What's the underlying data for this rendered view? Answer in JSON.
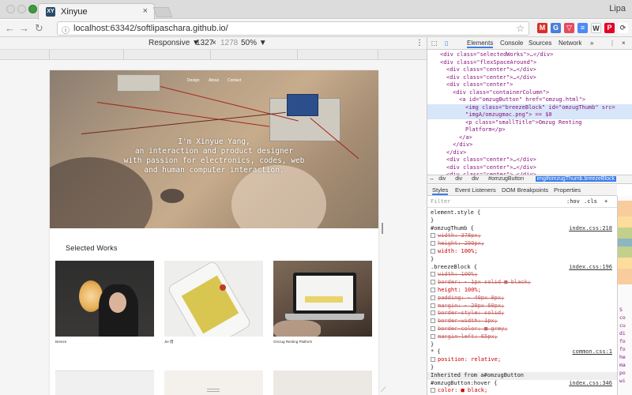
{
  "browser": {
    "tab_title": "Xinyue",
    "tab_favicon": "XY",
    "user_name": "Lipa",
    "url": "localhost:63342/softlipaschara.github.io/",
    "extension_icons": [
      "gmail-icon",
      "translate-icon",
      "pocket-icon",
      "docs-icon",
      "wikipedia-icon",
      "pinterest-icon",
      "sync-icon"
    ]
  },
  "device_toolbar": {
    "mode": "Responsive ▼",
    "width": "1327",
    "times": "×",
    "height": "1278",
    "zoom": "50% ▼"
  },
  "site": {
    "nav": [
      "Design",
      "About",
      "Contact"
    ],
    "hero_lines": [
      "I'm Xinyue Yang,",
      "an interaction and product designer",
      "with passion for electronics, codes, web",
      "and human computer interaction."
    ],
    "section_title": "Selected Works",
    "works": [
      {
        "caption": "Breeze",
        "thumb": "breeze-photo"
      },
      {
        "caption": "Jie 借",
        "thumb": "jie-phone-photo"
      },
      {
        "caption": "Omzug Renting Platform",
        "thumb": "omzug-laptop-photo"
      }
    ]
  },
  "devtools": {
    "tabs": [
      "Elements",
      "Console",
      "Sources",
      "Network",
      "»"
    ],
    "elements_lines": [
      {
        "indent": 2,
        "text": "<div class=\"selectedWorks\">…</div>"
      },
      {
        "indent": 2,
        "text": "<div class=\"flexSpaceAround\">"
      },
      {
        "indent": 3,
        "text": "<div class=\"center\">…</div>"
      },
      {
        "indent": 3,
        "text": "<div class=\"center\">…</div>"
      },
      {
        "indent": 3,
        "text": "<div class=\"center\">"
      },
      {
        "indent": 4,
        "text": "<div class=\"containerColumn\">"
      },
      {
        "indent": 5,
        "text": "<a id=\"omzugButton\" href=\"omzug.html\">"
      },
      {
        "indent": 6,
        "text": "<img class=\"breezeBlock\" id=\"omzugThumb\" src=",
        "selected": true
      },
      {
        "indent": 6,
        "text": "\"imgA/omzugmac.png\"> == $0",
        "selected": true
      },
      {
        "indent": 6,
        "text": "<p class=\"smallTitle\">Omzug Renting"
      },
      {
        "indent": 6,
        "text": "Platform</p>"
      },
      {
        "indent": 5,
        "text": "</a>"
      },
      {
        "indent": 4,
        "text": "</div>"
      },
      {
        "indent": 3,
        "text": "</div>"
      },
      {
        "indent": 3,
        "text": "<div class=\"center\">…</div>"
      },
      {
        "indent": 3,
        "text": "<div class=\"center\">…</div>"
      },
      {
        "indent": 3,
        "text": "<div class=\"center\">…</div>"
      }
    ],
    "breadcrumb": [
      "↔",
      "div",
      "div",
      "div",
      "#omzugButton",
      "img#omzugThumb.breezeBlock"
    ],
    "sub_tabs": [
      "Styles",
      "Event Listeners",
      "DOM Breakpoints",
      "Properties"
    ],
    "filter_placeholder": "Filter",
    "filter_controls": [
      ":hov",
      ".cls",
      "+"
    ],
    "styles_lines": [
      {
        "t": "element.style {",
        "kind": "sel"
      },
      {
        "t": "}",
        "kind": "sel"
      },
      {
        "t": "#omzugThumb {",
        "kind": "sel",
        "src": "index.css:218"
      },
      {
        "t": "width: 378px;",
        "kind": "strike"
      },
      {
        "t": "height: 290px;",
        "kind": "strike"
      },
      {
        "t": "width: 100%;",
        "kind": "prop"
      },
      {
        "t": "}",
        "kind": "sel"
      },
      {
        "t": ".breezeBlock {",
        "kind": "sel",
        "src": "index.css:196"
      },
      {
        "t": "width: 100%;",
        "kind": "strike"
      },
      {
        "t": "border: ▸ 1px solid ■ black;",
        "kind": "strike"
      },
      {
        "t": "height: 100%;",
        "kind": "prop"
      },
      {
        "t": "padding: ▸ 40px 0px;",
        "kind": "strike"
      },
      {
        "t": "margin: ▸ 20px 60px;",
        "kind": "strike"
      },
      {
        "t": "border-style: solid;",
        "kind": "strike"
      },
      {
        "t": "border-width: 1px;",
        "kind": "strike"
      },
      {
        "t": "border-color: ■ grey;",
        "kind": "strike"
      },
      {
        "t": "margin-left: 65px;",
        "kind": "strike"
      },
      {
        "t": "}",
        "kind": "sel"
      },
      {
        "t": "* {",
        "kind": "sel",
        "src": "common.css:1"
      },
      {
        "t": "position: relative;",
        "kind": "prop"
      },
      {
        "t": "}",
        "kind": "sel"
      },
      {
        "t": "Inherited from  a#omzugButton",
        "kind": "inherited"
      },
      {
        "t": "#omzugButton:hover {",
        "kind": "sel",
        "src": "index.css:346"
      },
      {
        "t": "color: ■ black;",
        "kind": "prop"
      }
    ],
    "side_labels": [
      "S",
      "co",
      "cu",
      "di",
      "fo",
      "fo",
      "he",
      "ma",
      "po",
      "wi"
    ]
  },
  "colors": {
    "accent": "#3b7de9",
    "tag": "#881280",
    "attr": "#994500",
    "attr_value": "#1a1aa6",
    "prop": "#c80000"
  }
}
